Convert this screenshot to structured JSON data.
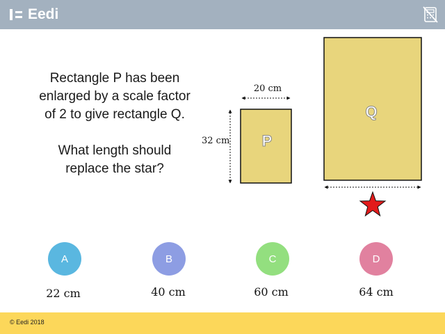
{
  "header": {
    "brand": "Eedi",
    "brand_icon": "eedi-logo-icon",
    "calculator_icon": "calculator-disallowed-icon",
    "background_color": "#a3b1bf"
  },
  "question": {
    "line1": "Rectangle P has been",
    "line2": "enlarged by a scale factor",
    "line3": "of 2 to give rectangle Q.",
    "line4": "What length should",
    "line5": "replace the star?"
  },
  "diagram": {
    "rect_p_label": "P",
    "rect_q_label": "Q",
    "width_label": "20 cm",
    "height_label": "32 cm",
    "rect_fill": "#e8d57c",
    "star_color": "#e21b1b",
    "star_icon": "star-icon"
  },
  "options": [
    {
      "letter": "A",
      "answer": "22 cm",
      "color": "#5ab7e0"
    },
    {
      "letter": "B",
      "answer": "40 cm",
      "color": "#8d9de3"
    },
    {
      "letter": "C",
      "answer": "60 cm",
      "color": "#93df7f"
    },
    {
      "letter": "D",
      "answer": "64 cm",
      "color": "#e1819f"
    }
  ],
  "footer": {
    "copyright": "© Eedi 2018",
    "background_color": "#fcd75a"
  }
}
